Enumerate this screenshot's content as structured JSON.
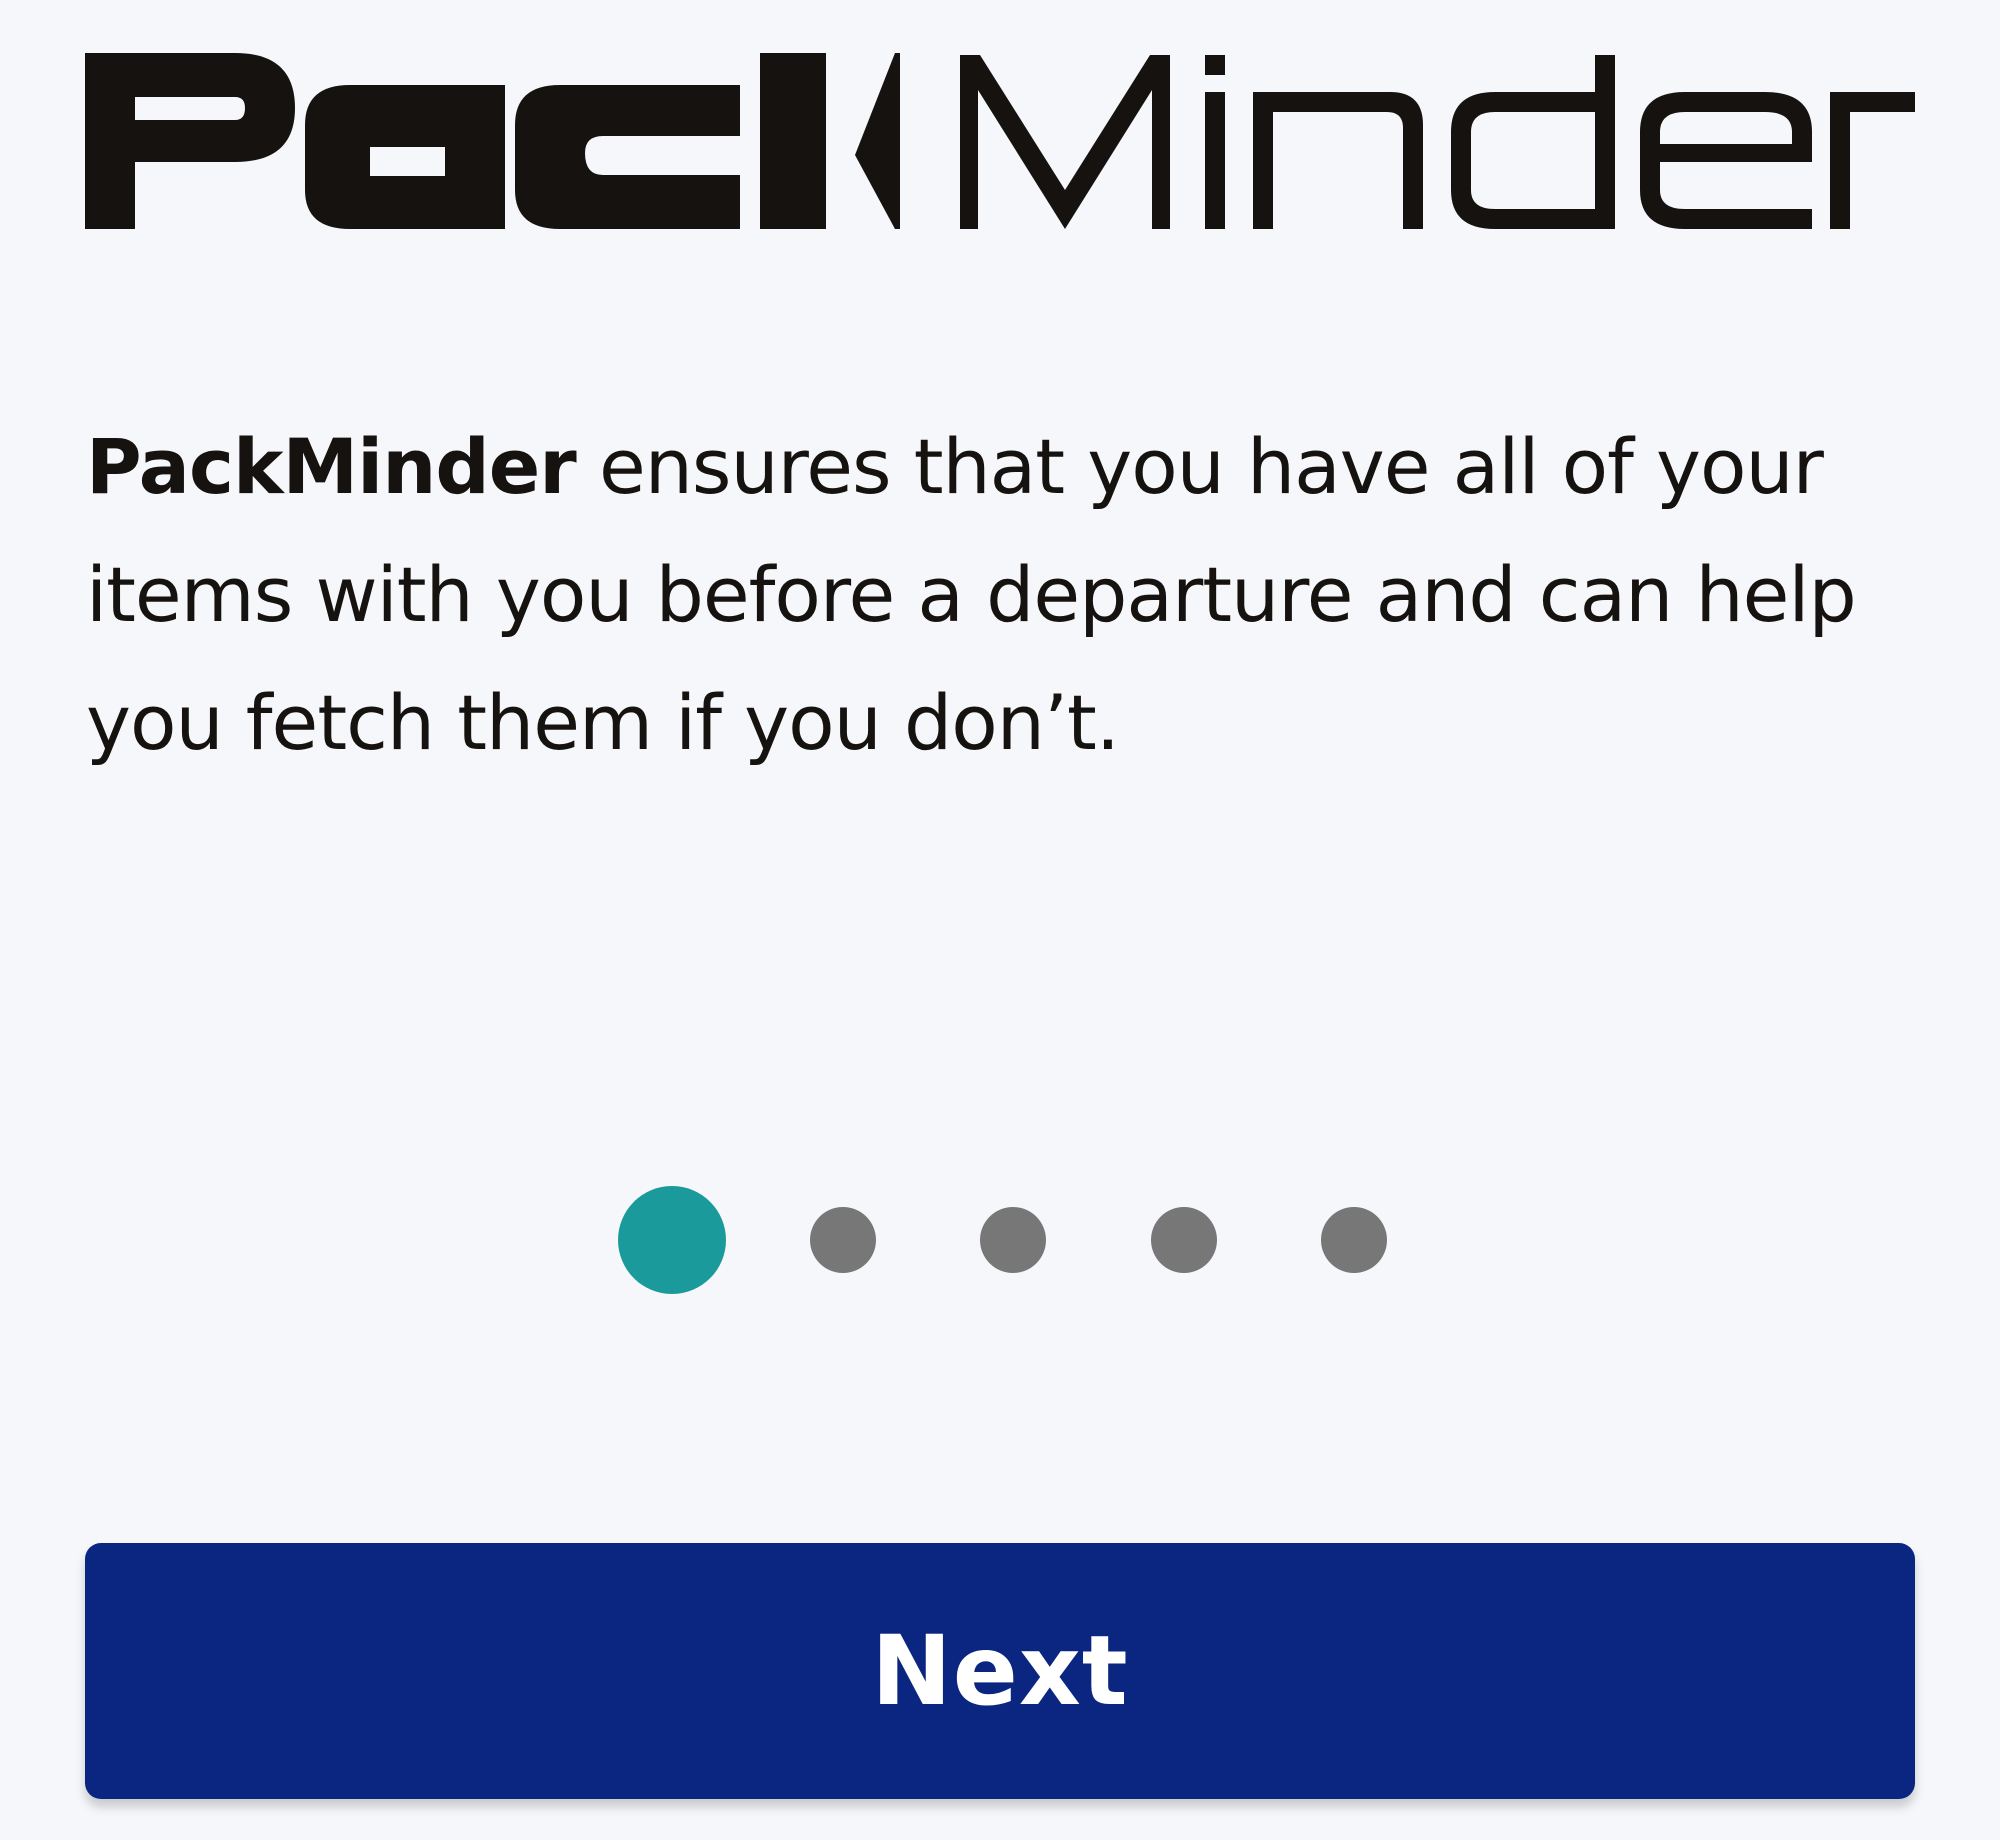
{
  "app": {
    "logo_text": "PackMinder",
    "logo_part_bold": "Pack",
    "logo_part_light": "Minder"
  },
  "onboarding": {
    "brand": "PackMinder",
    "description": "ensures that you have all of your items with you before a departure and can help you fetch them if you don’t."
  },
  "pager": {
    "current_page": 1,
    "total_pages": 5
  },
  "actions": {
    "next_label": "Next"
  },
  "colors": {
    "background": "#f5f7fb",
    "text": "#16120f",
    "accent_active_dot": "#1b9a9b",
    "inactive_dot": "#777777",
    "primary_button": "#0b2680"
  }
}
